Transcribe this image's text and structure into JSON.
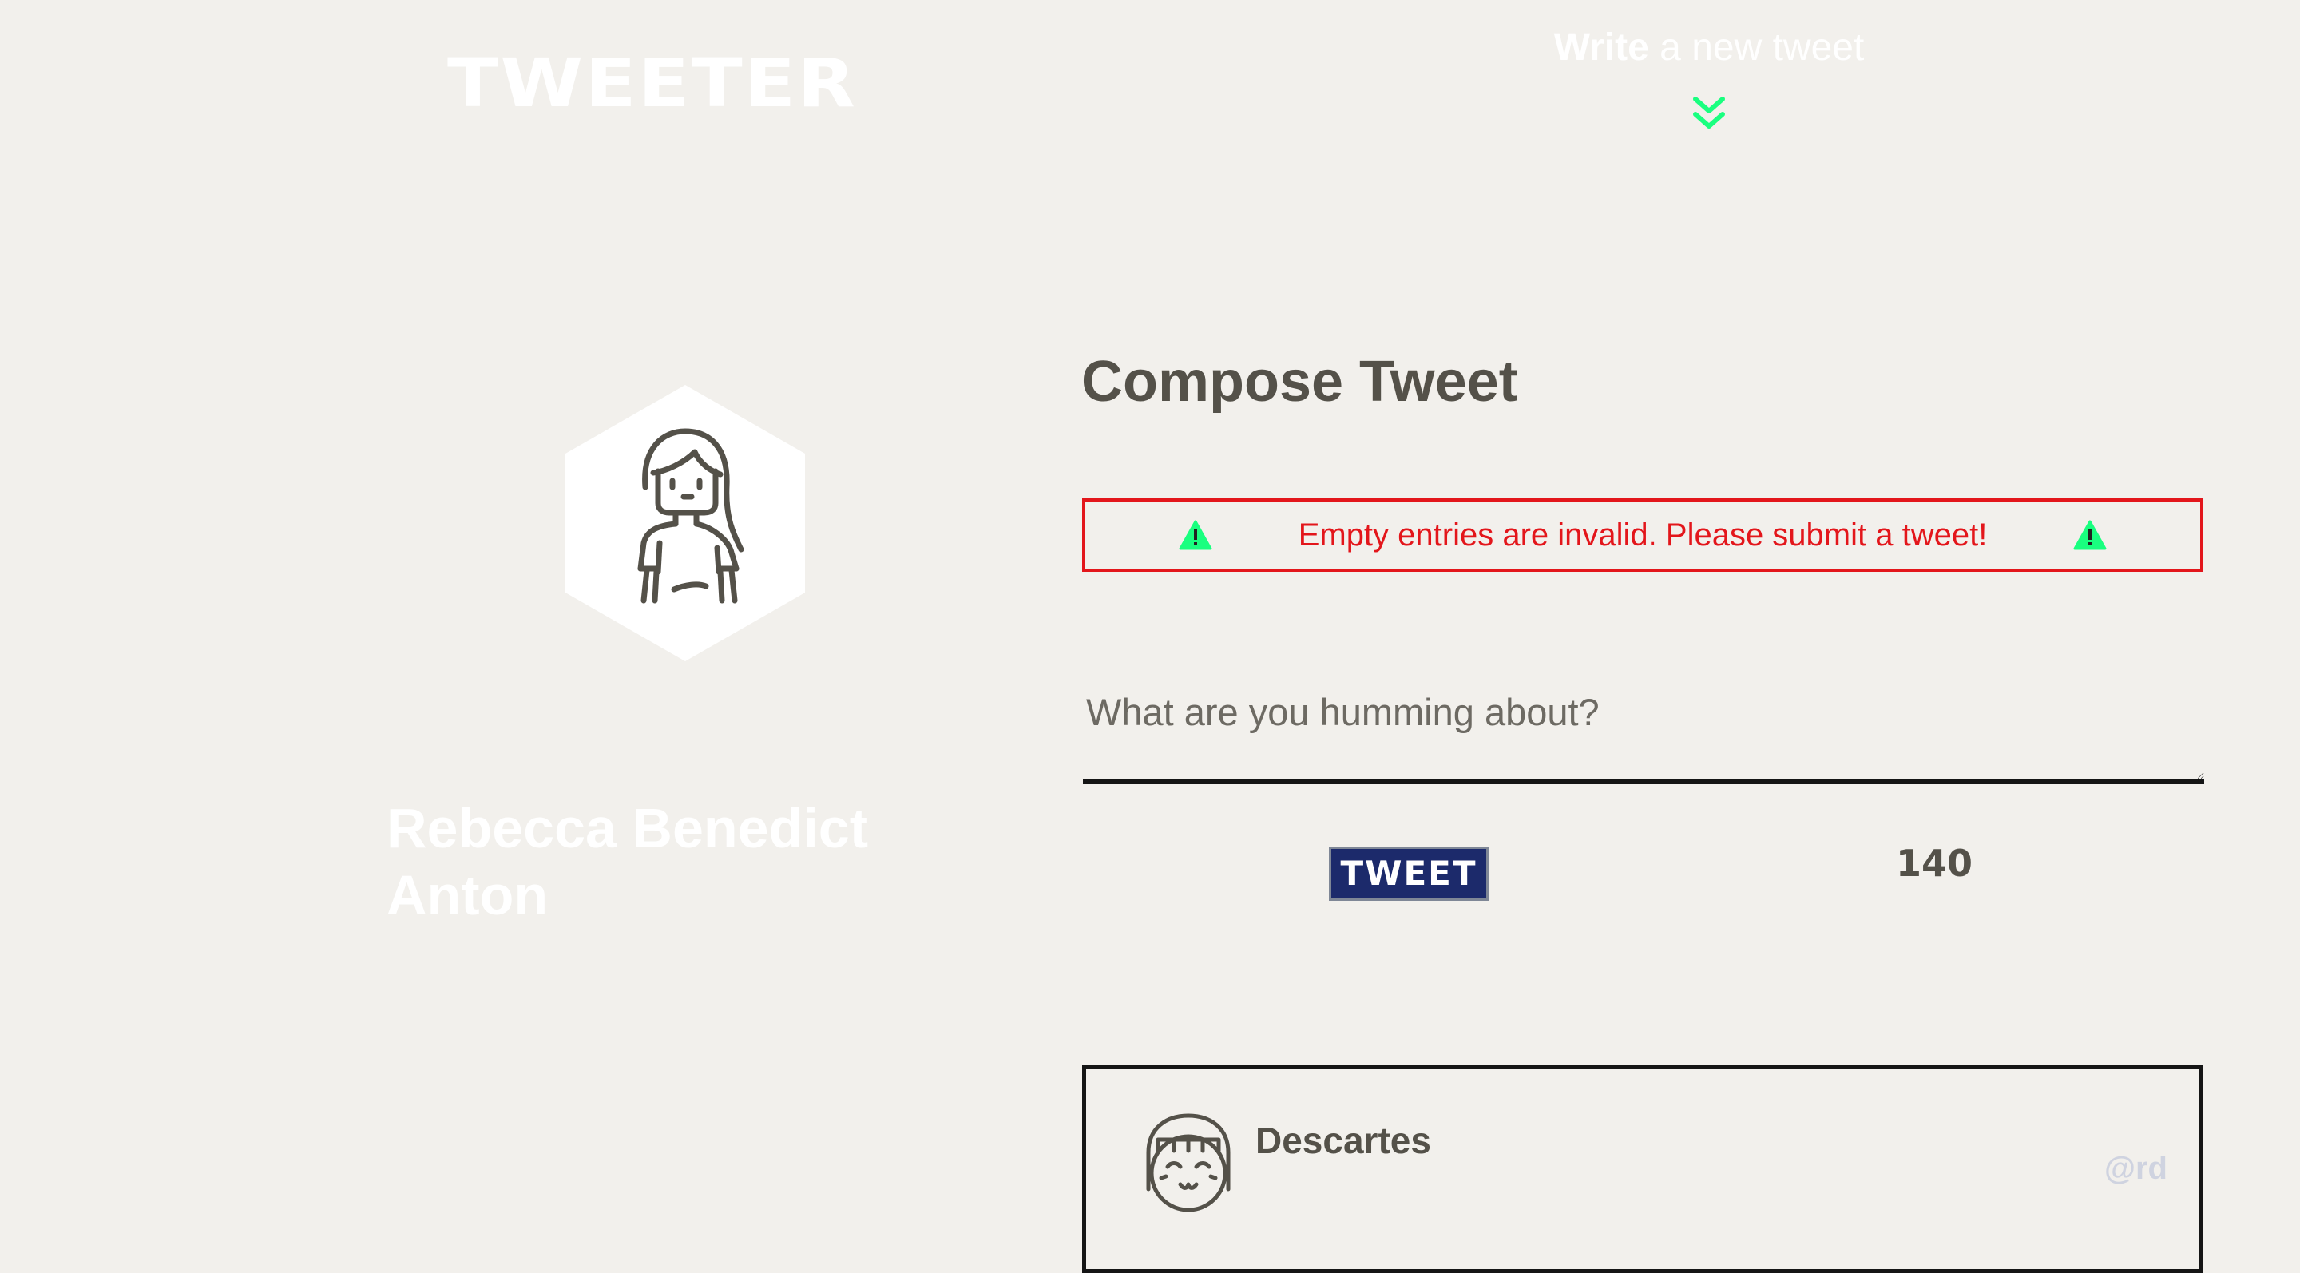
{
  "header": {
    "brand": "TWEETER",
    "nav_toggle": {
      "strong": "Write",
      "rest": " a new tweet",
      "arrow_icon": "double-chevron-down-icon"
    }
  },
  "profile": {
    "name": "Rebecca Benedict Anton",
    "avatar_icon": "woman-avatar-icon"
  },
  "compose": {
    "title": "Compose Tweet",
    "error": {
      "message": "Empty entries are invalid. Please submit a tweet!",
      "icon": "warning-triangle-icon"
    },
    "textarea": {
      "placeholder": "What are you humming about?",
      "value": ""
    },
    "submit_label": "TWEET",
    "counter": "140"
  },
  "tweets": [
    {
      "author": "Descartes",
      "handle": "@rd",
      "avatar_icon": "girl-avatar-icon"
    }
  ],
  "colors": {
    "background": "#f2f0ec",
    "text": "#545149",
    "error": "#e3161b",
    "accent": "#19ff7f",
    "button": "#1c2a6b",
    "handle": "#cfd3e0"
  }
}
